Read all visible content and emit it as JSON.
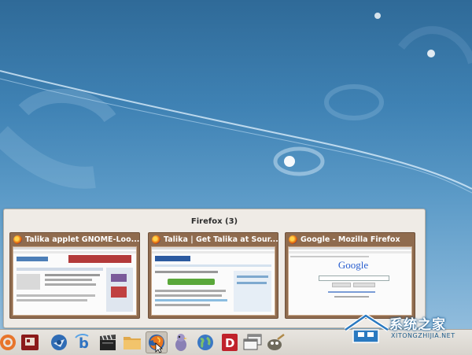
{
  "switcher": {
    "title": "Firefox (3)",
    "windows": [
      {
        "label": "Talika applet GNOME-Loo..."
      },
      {
        "label": "Talika | Get Talika at Sour..."
      },
      {
        "label": "Google - Mozilla Firefox"
      }
    ],
    "google_logo": "Google"
  },
  "taskbar": {
    "items": [
      {
        "icon": "ubuntu-logo-icon"
      },
      {
        "icon": "red-presentation-icon"
      },
      {
        "icon": "thunderbird-icon"
      },
      {
        "icon": "blog-b-icon"
      },
      {
        "icon": "video-clapper-icon"
      },
      {
        "icon": "folder-icon"
      },
      {
        "icon": "firefox-icon",
        "active": true
      },
      {
        "icon": "pidgin-icon"
      },
      {
        "icon": "globe-icon"
      },
      {
        "icon": "red-d-icon"
      },
      {
        "icon": "windows-stack-icon"
      },
      {
        "icon": "gimp-icon"
      }
    ]
  },
  "watermark": {
    "text": "系统之家",
    "sub": "XITONGZHIJIA.NET"
  },
  "colors": {
    "desktop_top": "#2f6a98",
    "desktop_bottom": "#9cc3e0",
    "switcher_bg": "#efebe6",
    "thumb_frame": "#8f6b4e"
  }
}
